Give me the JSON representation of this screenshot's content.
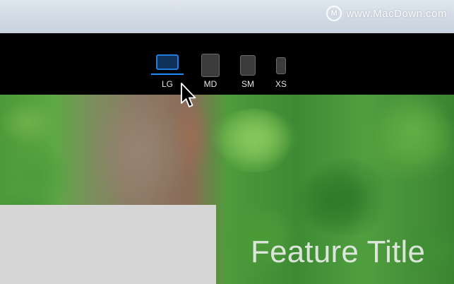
{
  "watermark": {
    "logo_glyph": "M",
    "text": "www.MacDown.com"
  },
  "device_toolbar": {
    "accent_color": "#1f8bff",
    "selected": "LG",
    "devices": [
      {
        "label": "LG",
        "icon": "laptop-icon"
      },
      {
        "label": "MD",
        "icon": "tablet-icon"
      },
      {
        "label": "SM",
        "icon": "phone-icon"
      },
      {
        "label": "XS",
        "icon": "small-phone-icon"
      }
    ]
  },
  "hero": {
    "feature_title": "Feature Title"
  },
  "pointer": {
    "icon": "arrow-cursor-icon"
  }
}
